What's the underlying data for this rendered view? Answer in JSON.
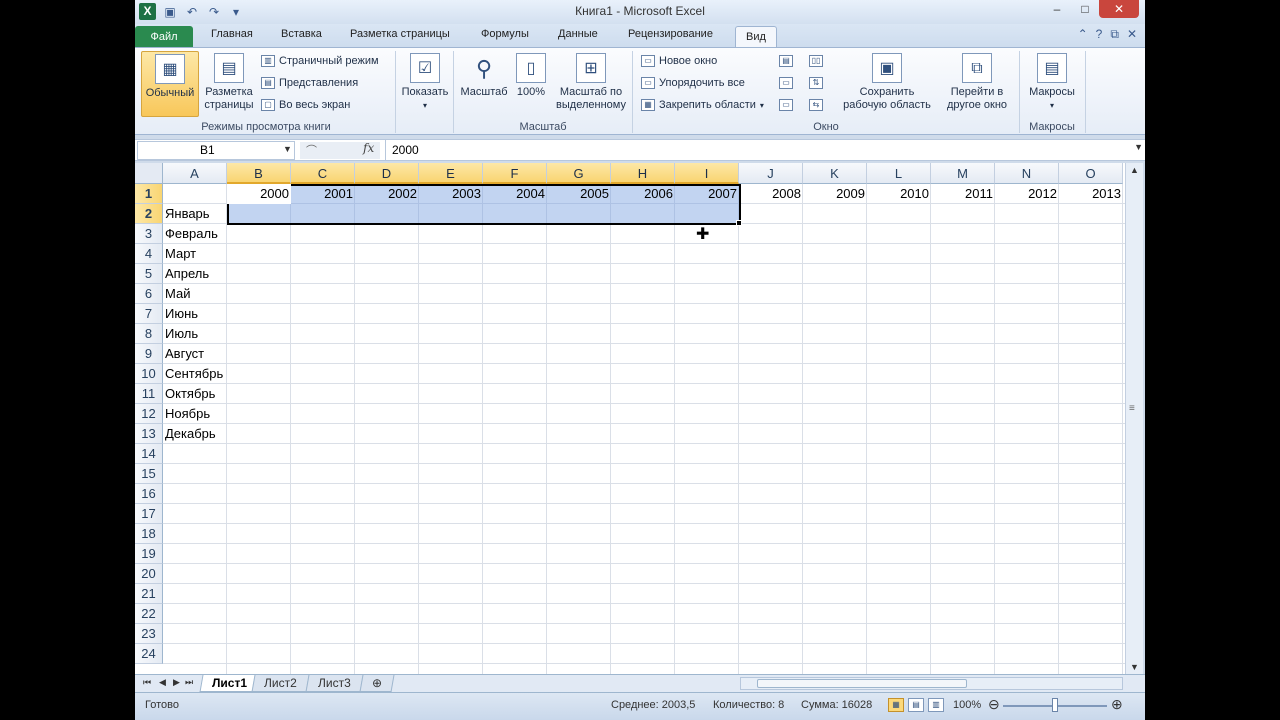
{
  "window": {
    "title": "Книга1  -  Microsoft Excel",
    "app_icon_letter": "X",
    "buttons": [
      "–",
      "□",
      "✕"
    ]
  },
  "tabs": [
    "Файл",
    "Главная",
    "Вставка",
    "Разметка страницы",
    "Формулы",
    "Данные",
    "Рецензирование",
    "Вид"
  ],
  "ribbon": {
    "groups": {
      "view_modes": {
        "label": "Режимы просмотра книги",
        "normal": "Обычный",
        "page_layout": "Разметка страницы",
        "page_break": "Страничный режим",
        "custom_views": "Представления",
        "full_screen": "Во весь экран"
      },
      "show": {
        "label": "Показать"
      },
      "zoom": {
        "label": "Масштаб",
        "zoom": "Масштаб",
        "hundred": "100%",
        "to_selection": "Масштаб по выделенному"
      },
      "window": {
        "label": "Окно",
        "new_window": "Новое окно",
        "arrange_all": "Упорядочить все",
        "freeze_panes": "Закрепить области",
        "save_workspace": "Сохранить рабочую область",
        "switch_windows": "Перейти в другое окно"
      },
      "macros": {
        "label": "Макросы",
        "macros": "Макросы"
      }
    }
  },
  "formula_bar": {
    "name_box": "B1",
    "fx": "fx",
    "value": "2000"
  },
  "sheet": {
    "columns": [
      "A",
      "B",
      "C",
      "D",
      "E",
      "F",
      "G",
      "H",
      "I",
      "J",
      "K",
      "L",
      "M",
      "N",
      "O"
    ],
    "selected_columns": [
      "B",
      "C",
      "D",
      "E",
      "F",
      "G",
      "H",
      "I"
    ],
    "rows": [
      "1",
      "2",
      "3",
      "4",
      "5",
      "6",
      "7",
      "8",
      "9",
      "10",
      "11",
      "12",
      "13",
      "14",
      "15",
      "16",
      "17",
      "18",
      "19",
      "20",
      "21",
      "22",
      "23",
      "24"
    ],
    "selected_rows": [
      "1",
      "2"
    ],
    "header_years": [
      "2000",
      "2001",
      "2002",
      "2003",
      "2004",
      "2005",
      "2006",
      "2007",
      "2008",
      "2009",
      "2010",
      "2011",
      "2012",
      "2013"
    ],
    "months": [
      "Январь",
      "Февраль",
      "Март",
      "Апрель",
      "Май",
      "Июнь",
      "Июль",
      "Август",
      "Сентябрь",
      "Октябрь",
      "Ноябрь",
      "Декабрь"
    ]
  },
  "sheet_tabs": [
    "Лист1",
    "Лист2",
    "Лист3"
  ],
  "status": {
    "ready": "Готово",
    "average": "Среднее: 2003,5",
    "count": "Количество: 8",
    "sum": "Сумма: 16028",
    "zoom": "100%"
  },
  "colors": {
    "file_tab": "#2a8a4f",
    "selection": "#a6c2ea",
    "header_selected": "#f9d572"
  }
}
